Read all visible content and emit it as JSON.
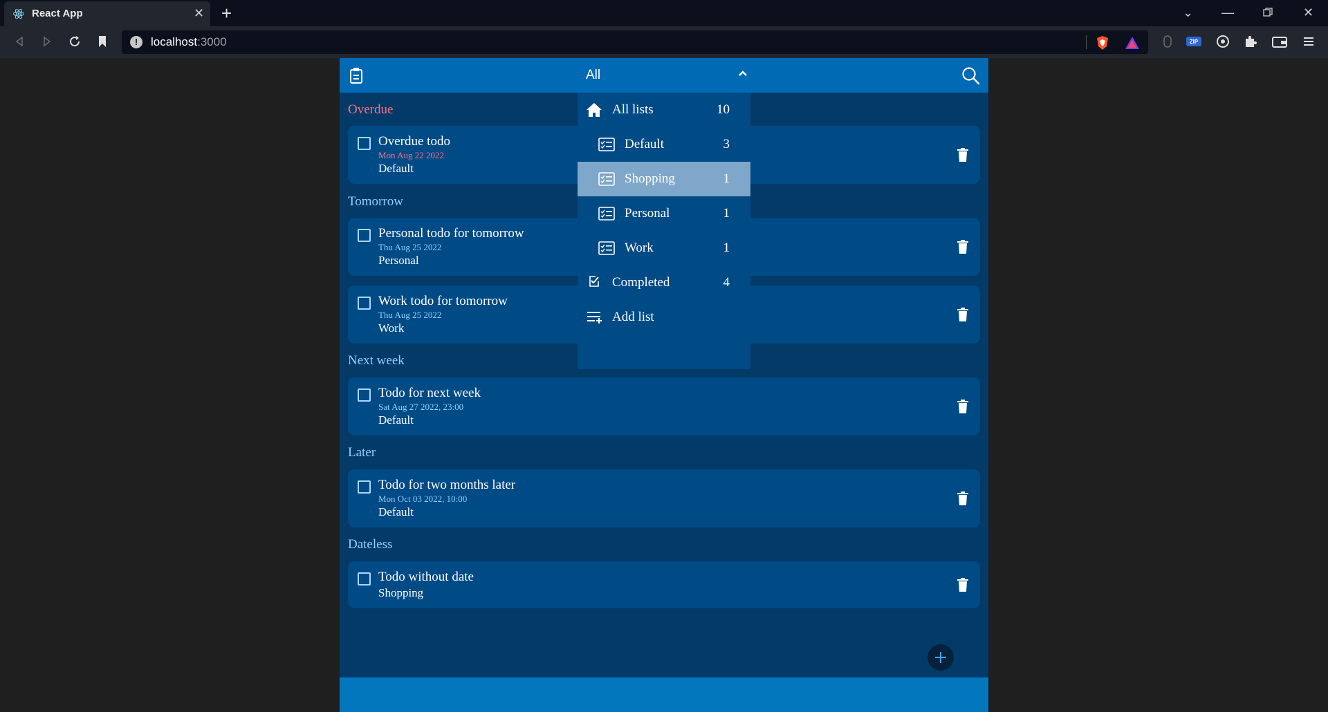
{
  "browser": {
    "tab_title": "React App",
    "url_host": "localhost",
    "url_port": ":3000"
  },
  "header": {
    "title": "All"
  },
  "sections": {
    "overdue": "Overdue",
    "tomorrow": "Tomorrow",
    "next_week": "Next week",
    "later": "Later",
    "dateless": "Dateless"
  },
  "todos": [
    {
      "title": "Overdue todo",
      "date": "Mon Aug 22 2022",
      "list": "Default"
    },
    {
      "title": "Personal todo for tomorrow",
      "date": "Thu Aug 25 2022",
      "list": "Personal"
    },
    {
      "title": "Work todo for tomorrow",
      "date": "Thu Aug 25 2022",
      "list": "Work"
    },
    {
      "title": "Todo for next week",
      "date": "Sat Aug 27 2022, 23:00",
      "list": "Default"
    },
    {
      "title": "Todo for two months later",
      "date": "Mon Oct 03 2022, 10:00",
      "list": "Default"
    },
    {
      "title": "Todo without date",
      "date": "",
      "list": "Shopping"
    }
  ],
  "dropdown": {
    "items": [
      {
        "label": "All lists",
        "count": "10",
        "icon": "home-icon"
      },
      {
        "label": "Default",
        "count": "3",
        "icon": "list-icon"
      },
      {
        "label": "Shopping",
        "count": "1",
        "icon": "list-icon",
        "selected": true
      },
      {
        "label": "Personal",
        "count": "1",
        "icon": "list-icon"
      },
      {
        "label": "Work",
        "count": "1",
        "icon": "list-icon"
      },
      {
        "label": "Completed",
        "count": "4",
        "icon": "check-icon"
      },
      {
        "label": "Add list",
        "count": "",
        "icon": "add-list-icon"
      }
    ]
  },
  "colors": {
    "header": "#006ab4",
    "background": "#033a68",
    "card": "#004a85",
    "section": "#8fd0ff",
    "overdue": "#ff6f7f",
    "selected": "#7fa7c9"
  }
}
